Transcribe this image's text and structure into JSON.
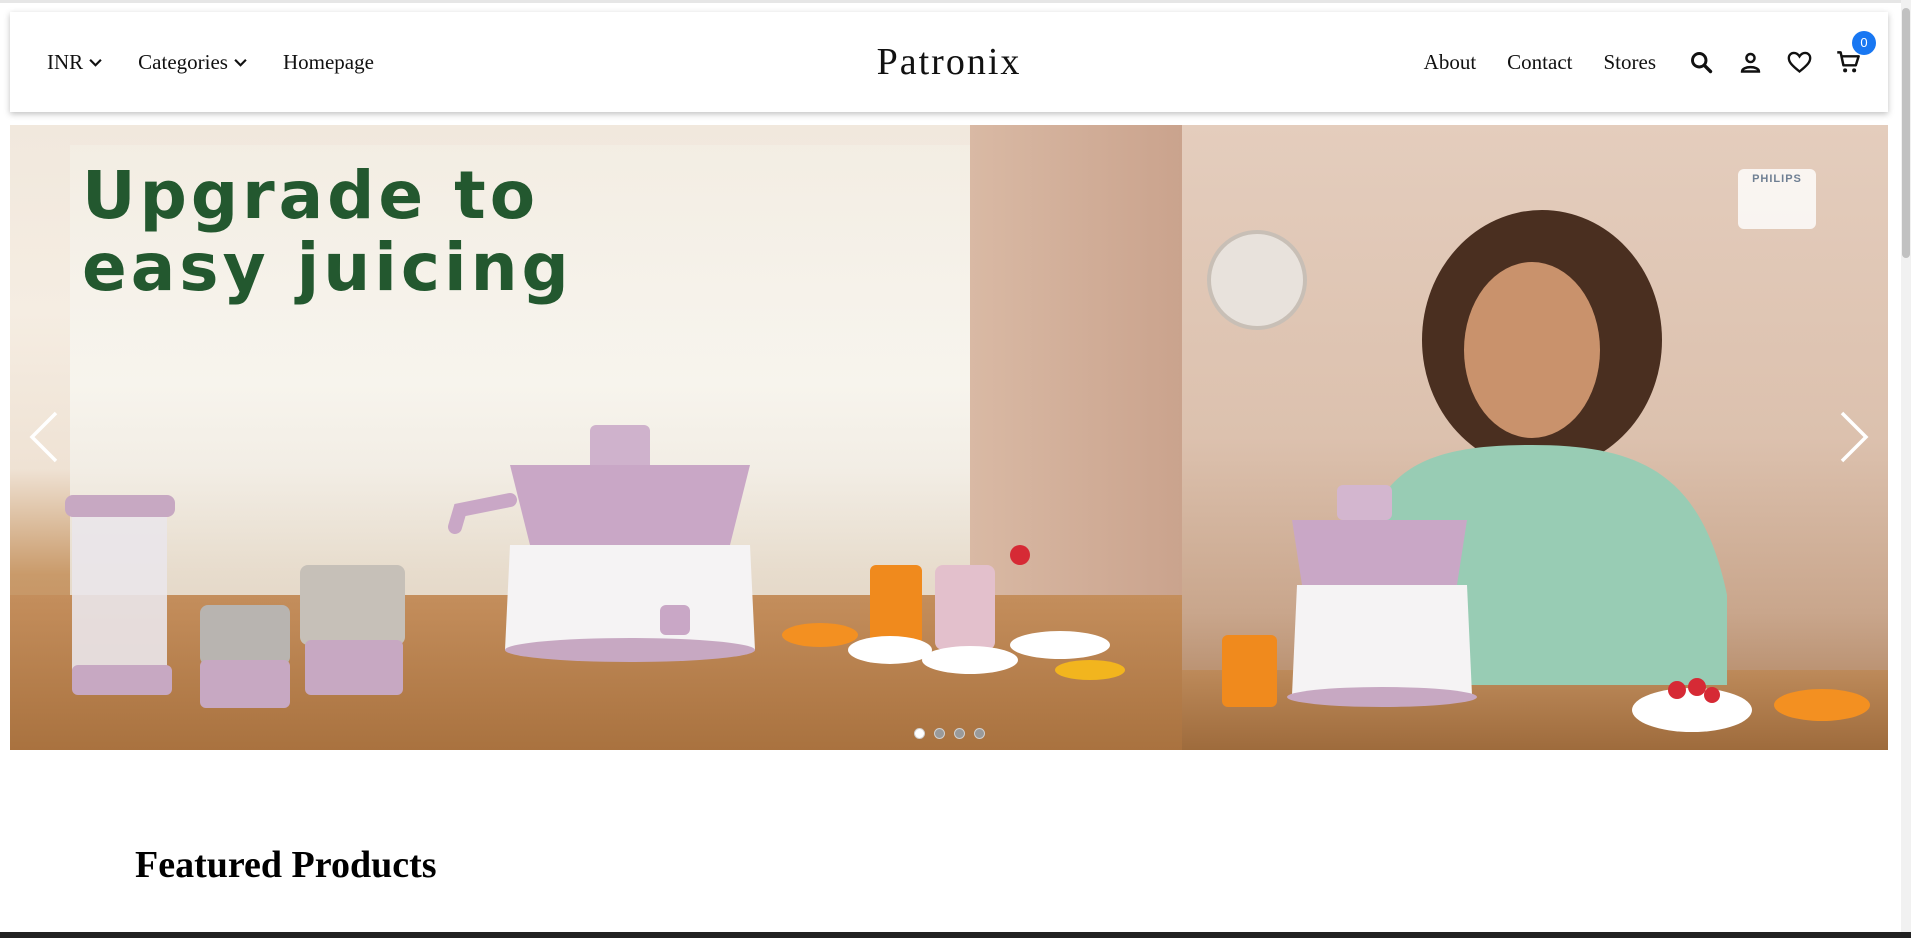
{
  "header": {
    "currency_label": "INR",
    "categories_label": "Categories",
    "homepage_label": "Homepage",
    "logo_text": "Patronix",
    "about_label": "About",
    "contact_label": "Contact",
    "stores_label": "Stores",
    "cart_count": "0",
    "icons": [
      "search-icon",
      "user-icon",
      "heart-icon",
      "cart-icon"
    ]
  },
  "hero": {
    "headline_line1": "Upgrade to",
    "headline_line2": "easy juicing",
    "brand_badge": "PHILIPS",
    "slide_count": 4,
    "active_slide": 1
  },
  "featured": {
    "title": "Featured Products"
  },
  "colors": {
    "headline": "#23582f",
    "badge": "#1877f2"
  }
}
